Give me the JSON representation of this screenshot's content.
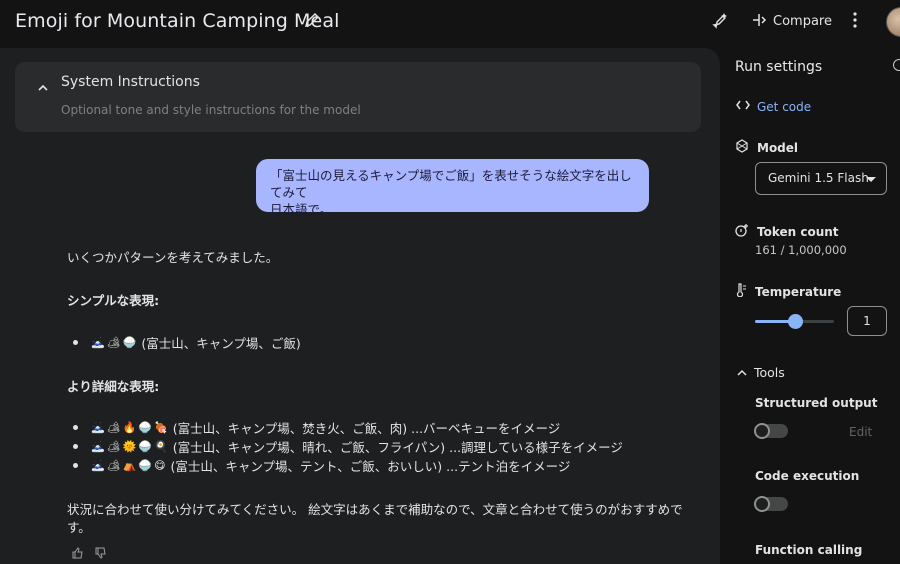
{
  "header": {
    "title": "Emoji for Mountain Camping Meal",
    "compare_label": "Compare"
  },
  "system_instructions": {
    "title": "System Instructions",
    "placeholder": "Optional tone and style instructions for the model"
  },
  "user_message": {
    "line1": "「富士山の見えるキャンプ場でご飯」を表せそうな絵文字を出してみて",
    "line2": "日本語で。"
  },
  "response": {
    "intro": "いくつかパターンを考えてみました。",
    "simple_heading": "シンプルな表現:",
    "simple_items": [
      {
        "emoji": [
          "🗻",
          "🏕",
          "🍚"
        ],
        "text": "(富士山、キャンプ場、ご飯)"
      }
    ],
    "detailed_heading": "より詳細な表現:",
    "detailed_items": [
      {
        "emoji": [
          "🗻",
          "🏕",
          "🔥",
          "🍚",
          "🍖"
        ],
        "text": "(富士山、キャンプ場、焚き火、ご飯、肉) ...バーベキューをイメージ"
      },
      {
        "emoji": [
          "🗻",
          "🏕",
          "🌞",
          "🍚",
          "🍳"
        ],
        "text": "(富士山、キャンプ場、晴れ、ご飯、フライパン) ...調理している様子をイメージ"
      },
      {
        "emoji": [
          "🗻",
          "🏕",
          "⛺",
          "🍚",
          "😋"
        ],
        "text": "(富士山、キャンプ場、テント、ご飯、おいしい) ...テント泊をイメージ"
      }
    ],
    "closing_line1": "状況に合わせて使い分けてみてください。 絵文字はあくまで補助なので、文章と合わせて使うのがおすすめで",
    "closing_line2": "す。"
  },
  "run_settings": {
    "title": "Run settings",
    "get_code": "Get code",
    "model_label": "Model",
    "model_value": "Gemini 1.5 Flash",
    "token_label": "Token count",
    "token_value": "161 / 1,000,000",
    "temperature_label": "Temperature",
    "temperature_value": "1",
    "temperature_fraction": 0.5,
    "tools_label": "Tools",
    "structured_output_label": "Structured output",
    "structured_output_edit": "Edit",
    "code_execution_label": "Code execution",
    "function_calling_label": "Function calling"
  },
  "colors": {
    "accent": "#8ab4f8",
    "user_bubble": "#a8b5ff",
    "panel_bg": "#1e1f20",
    "page_bg": "#131314"
  }
}
